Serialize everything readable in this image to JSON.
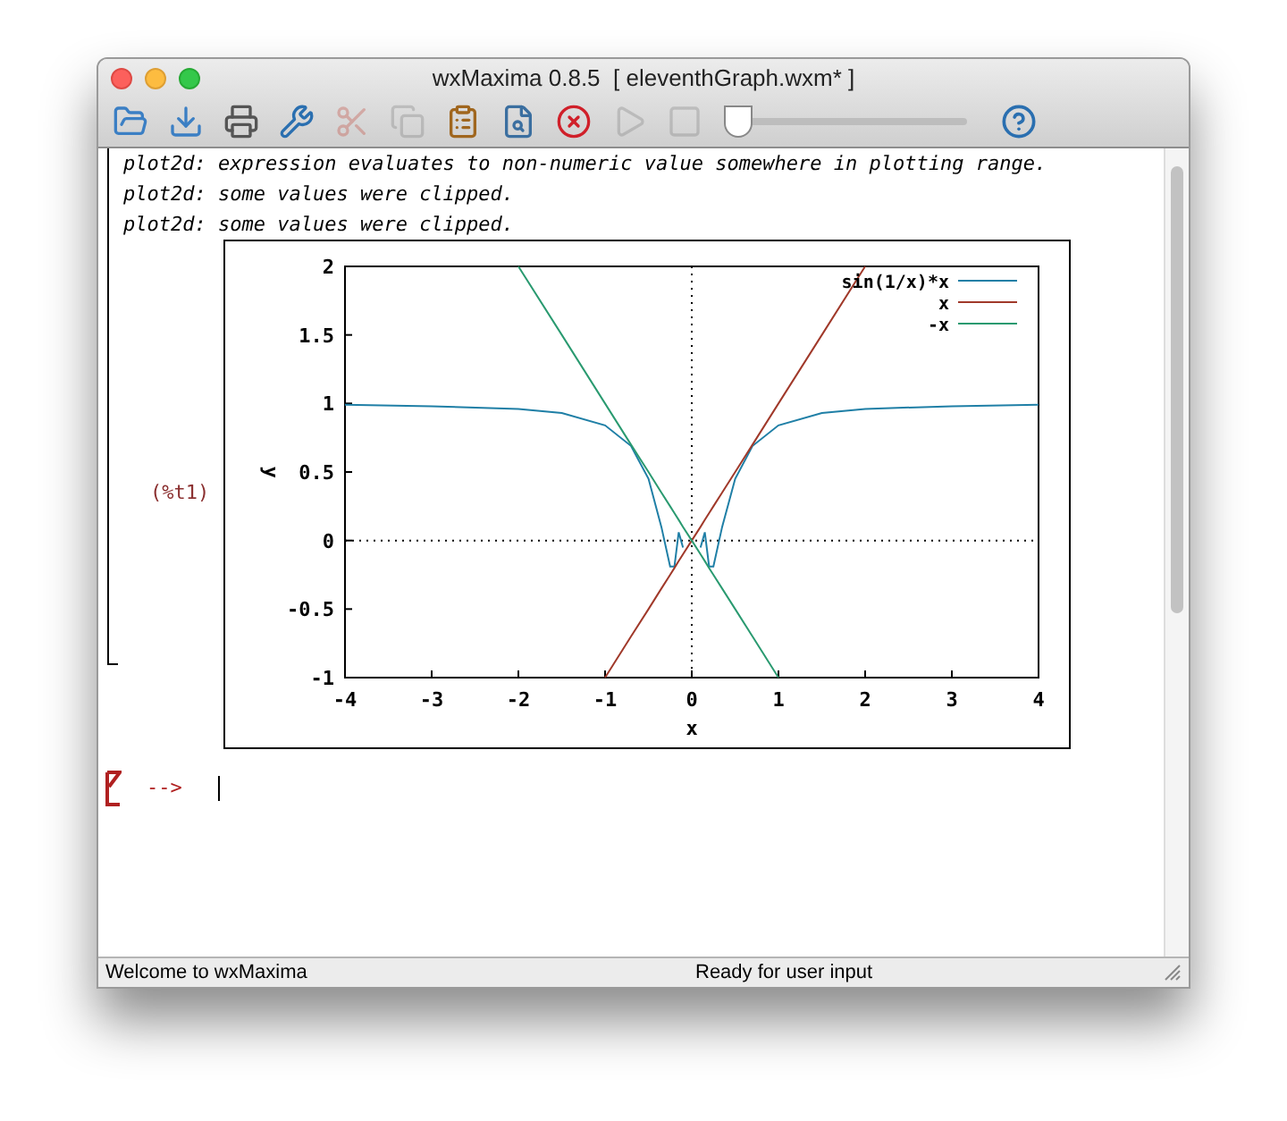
{
  "window": {
    "title": "wxMaxima 0.8.5  [ eleventhGraph.wxm* ]"
  },
  "toolbar": {
    "buttons": [
      {
        "kind": "open",
        "disabled": false
      },
      {
        "kind": "save",
        "disabled": false
      },
      {
        "kind": "print",
        "disabled": false
      },
      {
        "kind": "settings",
        "disabled": false
      },
      {
        "kind": "cut",
        "disabled": true
      },
      {
        "kind": "copy",
        "disabled": true
      },
      {
        "kind": "paste",
        "disabled": false
      },
      {
        "kind": "find",
        "disabled": false
      },
      {
        "kind": "interrupt",
        "disabled": false
      },
      {
        "kind": "play",
        "disabled": true
      },
      {
        "kind": "stop",
        "disabled": true
      }
    ],
    "slider": {
      "level": 0
    },
    "help": {
      "disabled": false
    }
  },
  "output": {
    "messages": [
      "plot2d: expression evaluates to non-numeric value somewhere in plotting range.",
      "plot2d: some values were clipped.",
      "plot2d: some values were clipped."
    ],
    "label": "(%t1)",
    "chart_data": {
      "type": "line",
      "legend": "top-right",
      "xlabel": "x",
      "ylabel": "y",
      "x": [
        -4,
        -3,
        -2,
        -1.5,
        -1,
        -0.7,
        -0.5,
        -0.35,
        -0.25,
        -0.2,
        -0.15,
        -0.1,
        0,
        0.1,
        0.15,
        0.2,
        0.25,
        0.35,
        0.5,
        0.7,
        1,
        1.5,
        2,
        3,
        4
      ],
      "xlim": [
        -4,
        4
      ],
      "ylim": [
        -1,
        2
      ],
      "xticks": [
        -4,
        -3,
        -2,
        -1,
        0,
        1,
        2,
        3,
        4
      ],
      "yticks": [
        -1,
        -0.5,
        0,
        0.5,
        1,
        1.5,
        2
      ],
      "series": [
        {
          "name": "sin(1/x)*x",
          "color": "#1f7fa6",
          "values": [
            0.99,
            0.98,
            0.96,
            0.93,
            0.84,
            0.69,
            0.45,
            0.1,
            -0.19,
            -0.19,
            0.06,
            -0.05,
            null,
            -0.05,
            0.06,
            -0.19,
            -0.19,
            0.1,
            0.45,
            0.69,
            0.84,
            0.93,
            0.96,
            0.98,
            0.99
          ]
        },
        {
          "name": "x",
          "color": "#a0392a",
          "values": [
            null,
            null,
            null,
            null,
            -1,
            -0.7,
            -0.5,
            -0.35,
            -0.25,
            -0.2,
            -0.15,
            -0.1,
            0,
            0.1,
            0.15,
            0.2,
            0.25,
            0.35,
            0.5,
            0.7,
            1,
            1.5,
            2,
            null,
            null
          ]
        },
        {
          "name": "-x",
          "color": "#2a9a70",
          "values": [
            null,
            null,
            2,
            1.5,
            1,
            0.7,
            0.5,
            0.35,
            0.25,
            0.2,
            0.15,
            0.1,
            0,
            -0.1,
            -0.15,
            -0.2,
            -0.25,
            -0.35,
            -0.5,
            -0.7,
            -1,
            null,
            null,
            null,
            null
          ]
        }
      ]
    }
  },
  "input": {
    "prompt": "-->"
  },
  "status_bar": {
    "left": "Welcome to wxMaxima",
    "right": "Ready for user input"
  }
}
